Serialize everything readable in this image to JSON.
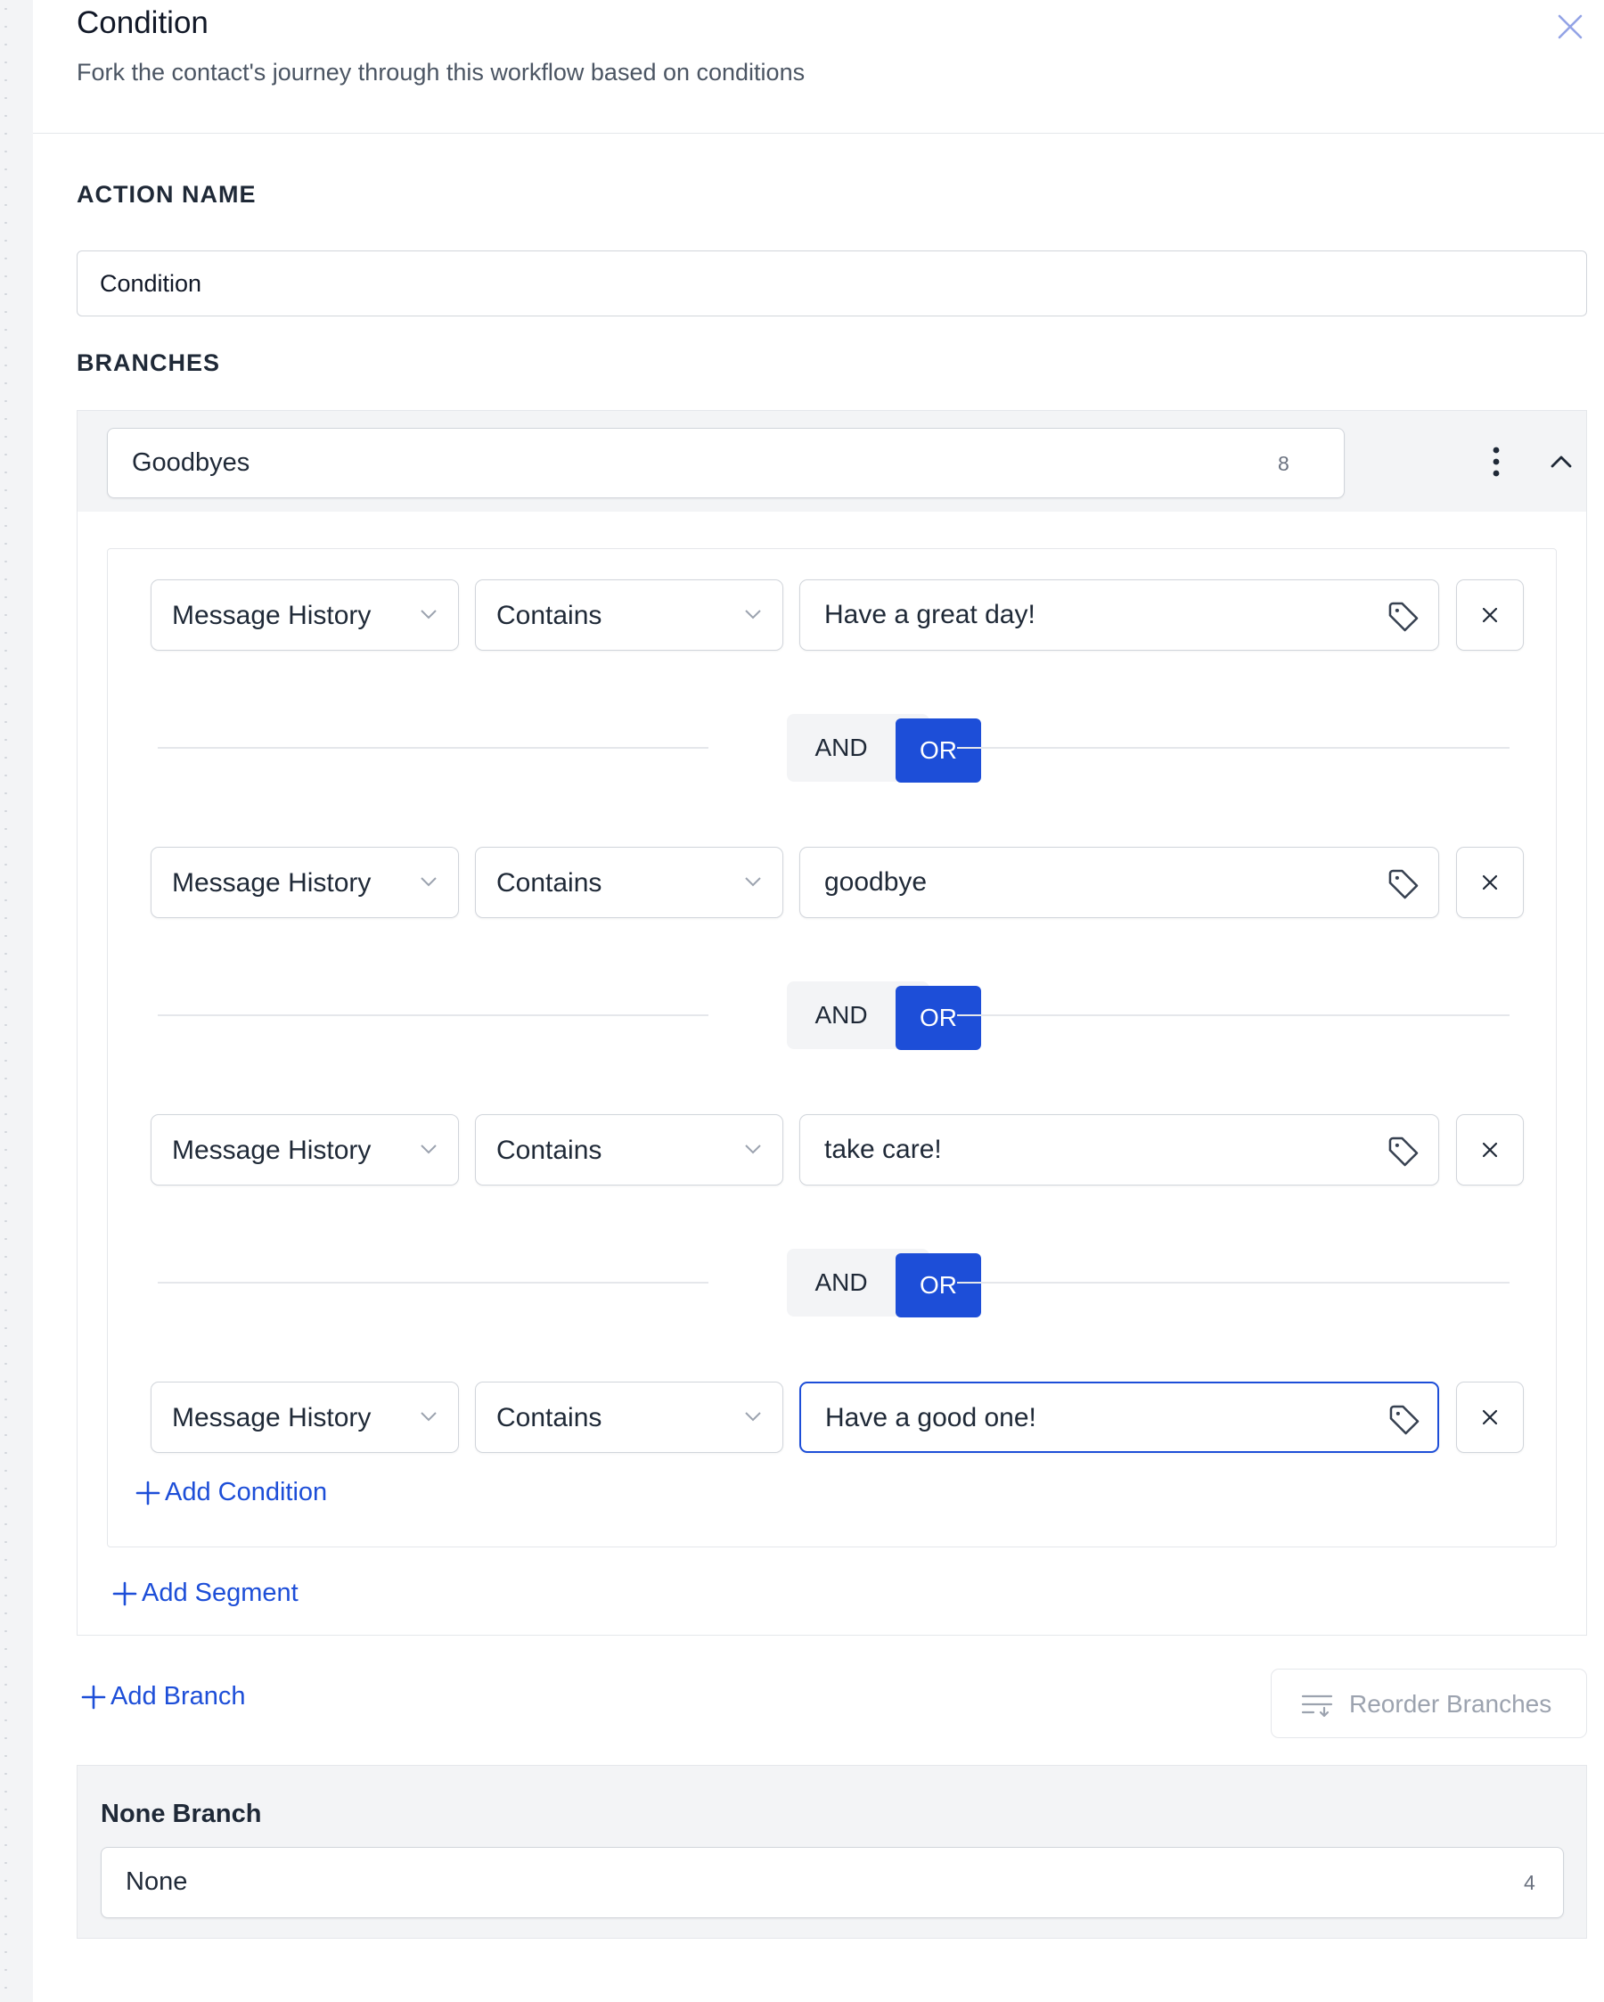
{
  "header": {
    "title": "Condition",
    "subtitle": "Fork the contact's journey through this workflow based on conditions"
  },
  "action_name": {
    "label": "ACTION NAME",
    "value": "Condition"
  },
  "branches": {
    "label": "BRANCHES",
    "branch": {
      "name": "Goodbyes",
      "count": "8",
      "conditions": [
        {
          "field": "Message History",
          "operator": "Contains",
          "value": "Have a great day!"
        },
        {
          "field": "Message History",
          "operator": "Contains",
          "value": "goodbye"
        },
        {
          "field": "Message History",
          "operator": "Contains",
          "value": "take care!"
        },
        {
          "field": "Message History",
          "operator": "Contains",
          "value": "Have a good one!"
        }
      ],
      "connectors": [
        {
          "and": "AND",
          "or": "OR",
          "selected": "OR"
        },
        {
          "and": "AND",
          "or": "OR",
          "selected": "OR"
        },
        {
          "and": "AND",
          "or": "OR",
          "selected": "OR"
        }
      ],
      "add_condition": "Add Condition",
      "add_segment": "Add Segment"
    },
    "add_branch": "Add Branch",
    "reorder_branches": "Reorder Branches"
  },
  "none_branch": {
    "title": "None Branch",
    "name": "None",
    "count": "4"
  },
  "colors": {
    "accent": "#1d4ed8",
    "border": "#d1d5db",
    "muted_bg": "#f3f4f6"
  },
  "icons": [
    "close-icon",
    "kebab-icon",
    "chevron-up-icon",
    "chevron-down-icon",
    "tag-icon",
    "x-icon",
    "plus-icon",
    "reorder-icon"
  ]
}
